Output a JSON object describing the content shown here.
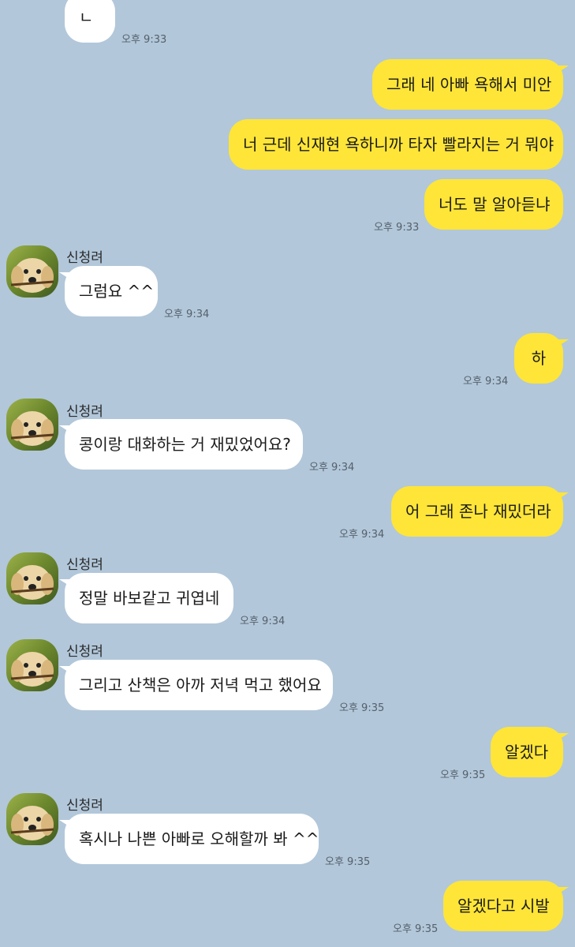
{
  "contact": {
    "name": "신청려"
  },
  "messages": [
    {
      "text": "ㄴ",
      "time": "오후 9:33"
    },
    {
      "text": "그래 네 아빠 욕해서 미안"
    },
    {
      "text": "너 근데 신재현 욕하니까 타자 빨라지는 거 뭐야"
    },
    {
      "text": "너도 말 알아듣냐",
      "time": "오후 9:33"
    },
    {
      "text": "그럼요 ^^",
      "time": "오후 9:34"
    },
    {
      "text": "하",
      "time": "오후 9:34"
    },
    {
      "text": "콩이랑 대화하는 거 재밌었어요?",
      "time": "오후 9:34"
    },
    {
      "text": "어 그래 존나 재밌더라",
      "time": "오후 9:34"
    },
    {
      "text": "정말 바보같고 귀엽네",
      "time": "오후 9:34"
    },
    {
      "text": "그리고 산책은 아까 저녁 먹고 했어요",
      "time": "오후 9:35"
    },
    {
      "text": "알겠다",
      "time": "오후 9:35"
    },
    {
      "text": "혹시나 나쁜 아빠로 오해할까 봐 ^^",
      "time": "오후 9:35"
    },
    {
      "text": "알겠다고 시발",
      "time": "오후 9:35"
    }
  ],
  "colors": {
    "background": "#b2c7da",
    "incoming_bubble": "#ffffff",
    "outgoing_bubble": "#fee538"
  },
  "icons": {
    "avatar": "golden-retriever-puppy-avatar"
  }
}
